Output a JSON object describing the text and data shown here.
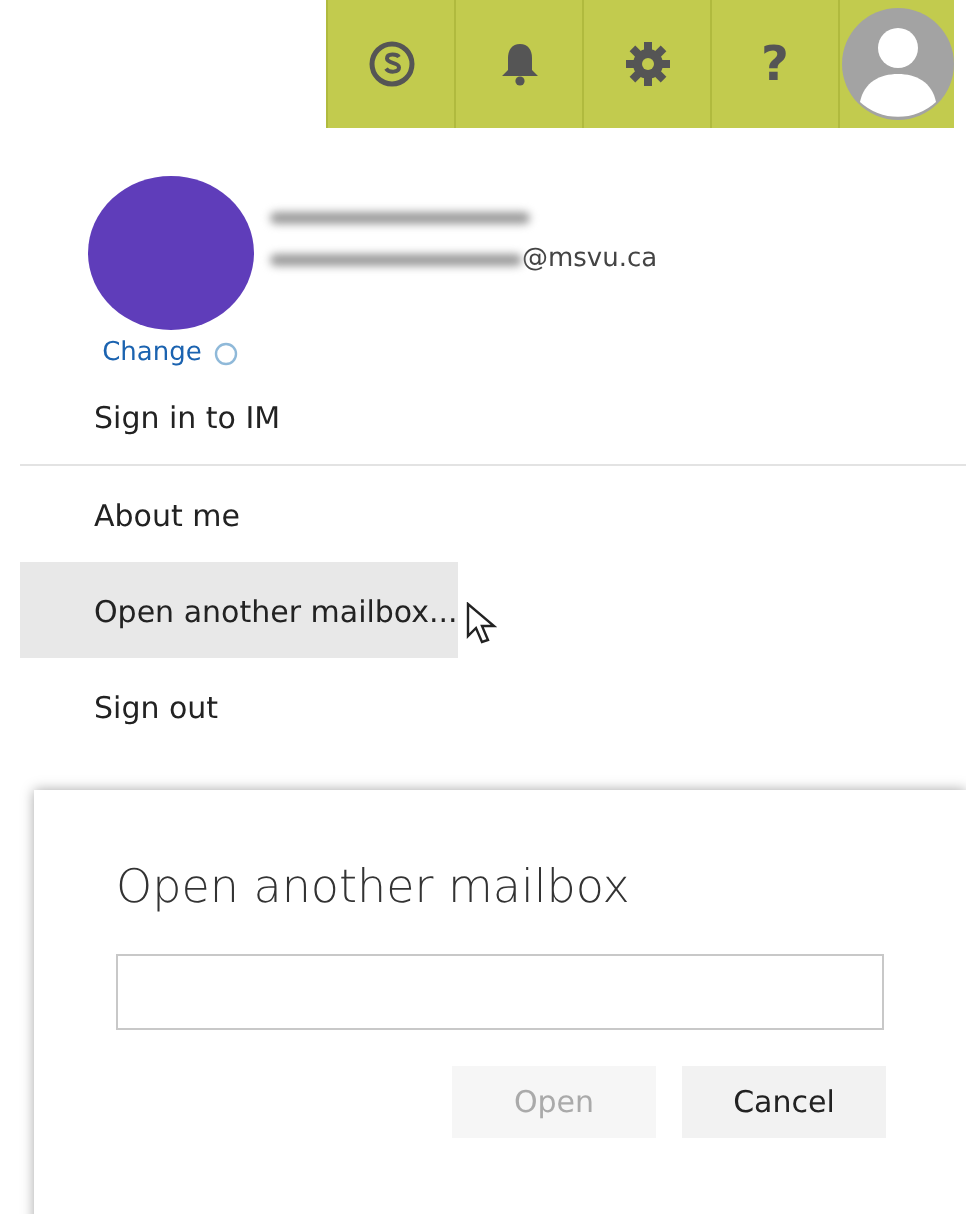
{
  "top_bar": {
    "buttons": [
      {
        "kind": "skype"
      },
      {
        "kind": "bell"
      },
      {
        "kind": "gear"
      },
      {
        "kind": "help",
        "label": "?"
      },
      {
        "kind": "avatar"
      }
    ]
  },
  "profile": {
    "email_suffix": "@msvu.ca",
    "change_link": "Change"
  },
  "menu": [
    {
      "label": "Sign in to IM",
      "selected": false,
      "divider_after": true
    },
    {
      "label": "About me",
      "selected": false,
      "divider_after": false
    },
    {
      "label": "Open another mailbox...",
      "selected": true,
      "divider_after": false
    },
    {
      "label": "Sign out",
      "selected": false,
      "divider_after": false
    }
  ],
  "dialog": {
    "title": "Open another mailbox",
    "buttons": [
      {
        "label": "Open",
        "disabled": true
      },
      {
        "label": "Cancel",
        "disabled": false
      }
    ]
  }
}
